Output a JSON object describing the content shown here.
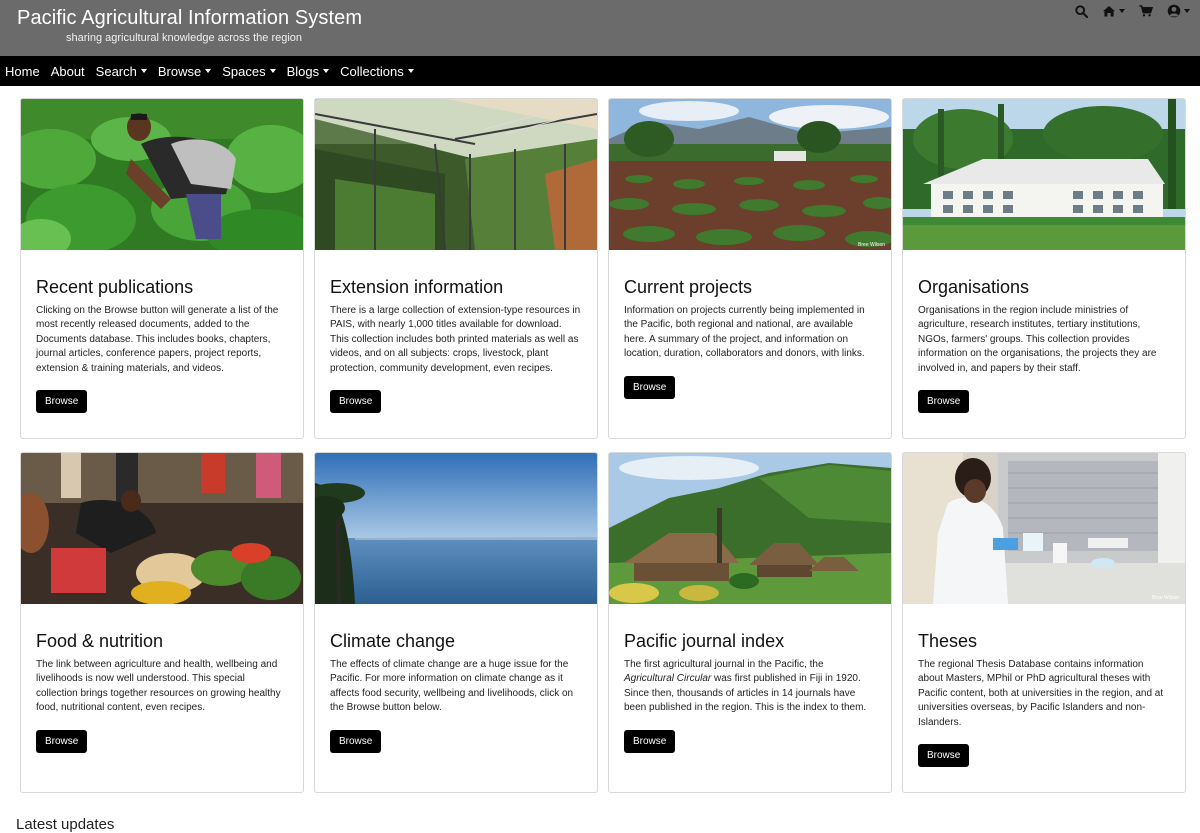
{
  "header": {
    "title": "Pacific Agricultural Information System",
    "tagline": "sharing agricultural knowledge across the region",
    "icons": [
      "search-icon",
      "home-icon",
      "cart-icon",
      "user-icon"
    ]
  },
  "nav": {
    "items": [
      {
        "label": "Home",
        "dropdown": false
      },
      {
        "label": "About",
        "dropdown": false
      },
      {
        "label": "Search",
        "dropdown": true
      },
      {
        "label": "Browse",
        "dropdown": true
      },
      {
        "label": "Spaces",
        "dropdown": true
      },
      {
        "label": "Blogs",
        "dropdown": true
      },
      {
        "label": "Collections",
        "dropdown": true
      }
    ]
  },
  "cards": [
    {
      "title": "Recent publications",
      "text": "Clicking on the Browse button will generate a list of the most recently released documents, added to the Documents database. This includes books, chapters, journal articles, conference papers, project reports, extension & training materials, and videos.",
      "button": "Browse"
    },
    {
      "title": "Extension information",
      "text": "There is a large collection of extension-type resources in PAIS, with nearly 1,000 titles available for download. This collection includes both printed materials as well as videos, and on all subjects: crops, livestock, plant protection, community development, even recipes.",
      "button": "Browse"
    },
    {
      "title": "Current projects",
      "text": "Information on projects currently being implemented in the Pacific, both regional and national, are available here. A summary of the project, and information on location, duration, collaborators and donors, with links.",
      "button": "Browse"
    },
    {
      "title": "Organisations",
      "text": "Organisations in the region include ministries of agriculture, research institutes, tertiary institutions, NGOs, farmers' groups. This collection provides information on the organisations, the projects they are involved in, and papers by their staff.",
      "button": "Browse"
    },
    {
      "title": "Food & nutrition",
      "text": "The link between agriculture and health, wellbeing and livelihoods is now well understood. This special collection brings together resources on growing healthy food, nutritional content, even recipes.",
      "button": "Browse"
    },
    {
      "title": "Climate change",
      "text": "The effects of climate change are a huge issue for the Pacific. For more information on climate change as it affects food security, wellbeing and livelihoods, click on the Browse button below.",
      "button": "Browse"
    },
    {
      "title": "Pacific journal index",
      "text_before": "The first agricultural journal in the Pacific, the ",
      "text_italic": "Agricultural Circular",
      "text_after": " was first published in Fiji in 1920. Since then, thousands of articles in 14 journals have been published in the region. This is the index to them.",
      "button": "Browse"
    },
    {
      "title": "Theses",
      "text": "The regional Thesis Database contains information about Masters, MPhil or PhD agricultural theses with Pacific content, both at universities in the region, and at universities overseas, by Pacific Islanders and non-Islanders.",
      "button": "Browse"
    }
  ],
  "photo_credit": "Bree Wilson",
  "below": {
    "title": "Latest updates"
  }
}
